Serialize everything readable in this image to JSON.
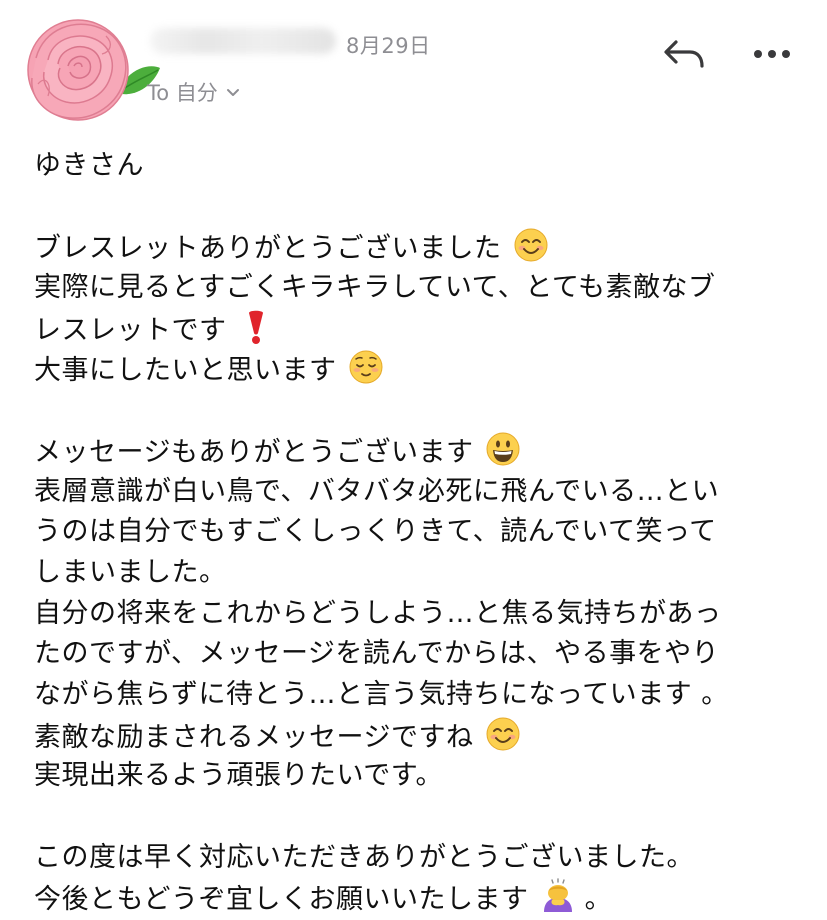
{
  "header": {
    "date": "8月29日",
    "recipient_label": "To 自分",
    "avatar_icon": "rose-icon",
    "reply_icon": "reply-icon",
    "more_icon": "more-dots-icon"
  },
  "message": {
    "greeting": "ゆきさん",
    "p1": {
      "l1": "ブレスレットありがとうございました",
      "l2": "実際に見るとすごくキラキラしていて、とても素敵なブ",
      "l3": "レスレットです",
      "l4": "大事にしたいと思います"
    },
    "p2": {
      "l1": "メッセージもありがとうございます",
      "l2": "表層意識が白い鳥で、バタバタ必死に飛んでいる…とい",
      "l3": "うのは自分でもすごくしっくりきて、読んでいて笑って",
      "l4": "しまいました。",
      "l5": "自分の将来をこれからどうしよう…と焦る気持ちがあっ",
      "l6": "たのですが、メッセージを読んでからは、やる事をやり",
      "l7": "ながら焦らずに待とう…と言う気持ちになっています 。",
      "l8": "素敵な励まされるメッセージですね",
      "l9": "実現出来るよう頑張りたいです。"
    },
    "p3": {
      "l1": "この度は早く対応いただきありがとうございました。",
      "l2a": "今後ともどうぞ宜しくお願いいたします",
      "l2b": "。"
    }
  }
}
